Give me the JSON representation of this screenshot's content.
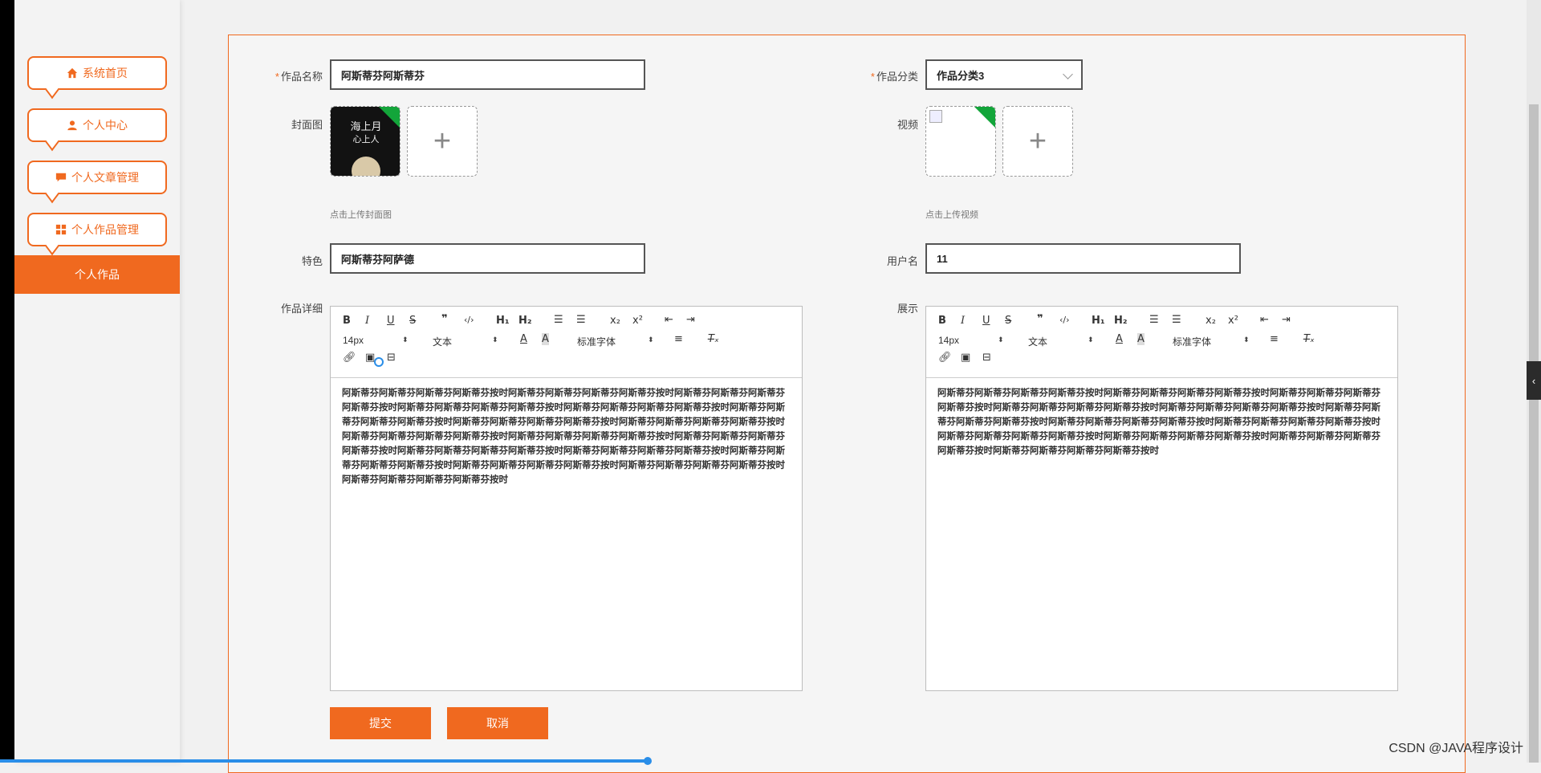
{
  "sidebar": {
    "items": [
      {
        "label": "系统首页",
        "icon": "home-icon"
      },
      {
        "label": "个人中心",
        "icon": "user-icon"
      },
      {
        "label": "个人文章管理",
        "icon": "chat-icon"
      },
      {
        "label": "个人作品管理",
        "icon": "grid-icon"
      }
    ],
    "active_label": "个人作品"
  },
  "form": {
    "name_label": "作品名称",
    "name_value": "阿斯蒂芬阿斯蒂芬",
    "category_label": "作品分类",
    "category_value": "作品分类3",
    "cover_label": "封面图",
    "cover_hint": "点击上传封面图",
    "video_label": "视频",
    "video_hint": "点击上传视频",
    "feature_label": "特色",
    "feature_value": "阿斯蒂芬阿萨德",
    "username_label": "用户名",
    "username_value": "11",
    "detail_label": "作品详细",
    "display_label": "展示",
    "submit_label": "提交",
    "cancel_label": "取消"
  },
  "editor": {
    "font_size": "14px",
    "text_type": "文本",
    "font_family": "标准字体",
    "detail_text": "阿斯蒂芬阿斯蒂芬阿斯蒂芬阿斯蒂芬按时阿斯蒂芬阿斯蒂芬阿斯蒂芬阿斯蒂芬按时阿斯蒂芬阿斯蒂芬阿斯蒂芬阿斯蒂芬按时阿斯蒂芬阿斯蒂芬阿斯蒂芬阿斯蒂芬按时阿斯蒂芬阿斯蒂芬阿斯蒂芬阿斯蒂芬按时阿斯蒂芬阿斯蒂芬阿斯蒂芬阿斯蒂芬按时阿斯蒂芬阿斯蒂芬阿斯蒂芬阿斯蒂芬按时阿斯蒂芬阿斯蒂芬阿斯蒂芬阿斯蒂芬按时阿斯蒂芬阿斯蒂芬阿斯蒂芬阿斯蒂芬按时阿斯蒂芬阿斯蒂芬阿斯蒂芬阿斯蒂芬按时阿斯蒂芬阿斯蒂芬阿斯蒂芬阿斯蒂芬按时阿斯蒂芬阿斯蒂芬阿斯蒂芬阿斯蒂芬按时阿斯蒂芬阿斯蒂芬阿斯蒂芬阿斯蒂芬按时阿斯蒂芬阿斯蒂芬阿斯蒂芬阿斯蒂芬按时阿斯蒂芬阿斯蒂芬阿斯蒂芬阿斯蒂芬按时阿斯蒂芬阿斯蒂芬阿斯蒂芬阿斯蒂芬按时阿斯蒂芬阿斯蒂芬阿斯蒂芬阿斯蒂芬按时",
    "display_text": "阿斯蒂芬阿斯蒂芬阿斯蒂芬阿斯蒂芬按时阿斯蒂芬阿斯蒂芬阿斯蒂芬阿斯蒂芬按时阿斯蒂芬阿斯蒂芬阿斯蒂芬阿斯蒂芬按时阿斯蒂芬阿斯蒂芬阿斯蒂芬阿斯蒂芬按时阿斯蒂芬阿斯蒂芬阿斯蒂芬阿斯蒂芬按时阿斯蒂芬阿斯蒂芬阿斯蒂芬阿斯蒂芬按时阿斯蒂芬阿斯蒂芬阿斯蒂芬阿斯蒂芬按时阿斯蒂芬阿斯蒂芬阿斯蒂芬阿斯蒂芬按时阿斯蒂芬阿斯蒂芬阿斯蒂芬阿斯蒂芬按时阿斯蒂芬阿斯蒂芬阿斯蒂芬阿斯蒂芬按时阿斯蒂芬阿斯蒂芬阿斯蒂芬阿斯蒂芬按时阿斯蒂芬阿斯蒂芬阿斯蒂芬阿斯蒂芬按时"
  },
  "cover_image_text": {
    "line1": "海上月",
    "line2": "心上人"
  },
  "watermark": "CSDN @JAVA程序设计",
  "colors": {
    "accent": "#f0691f",
    "badge": "#13a53a"
  }
}
